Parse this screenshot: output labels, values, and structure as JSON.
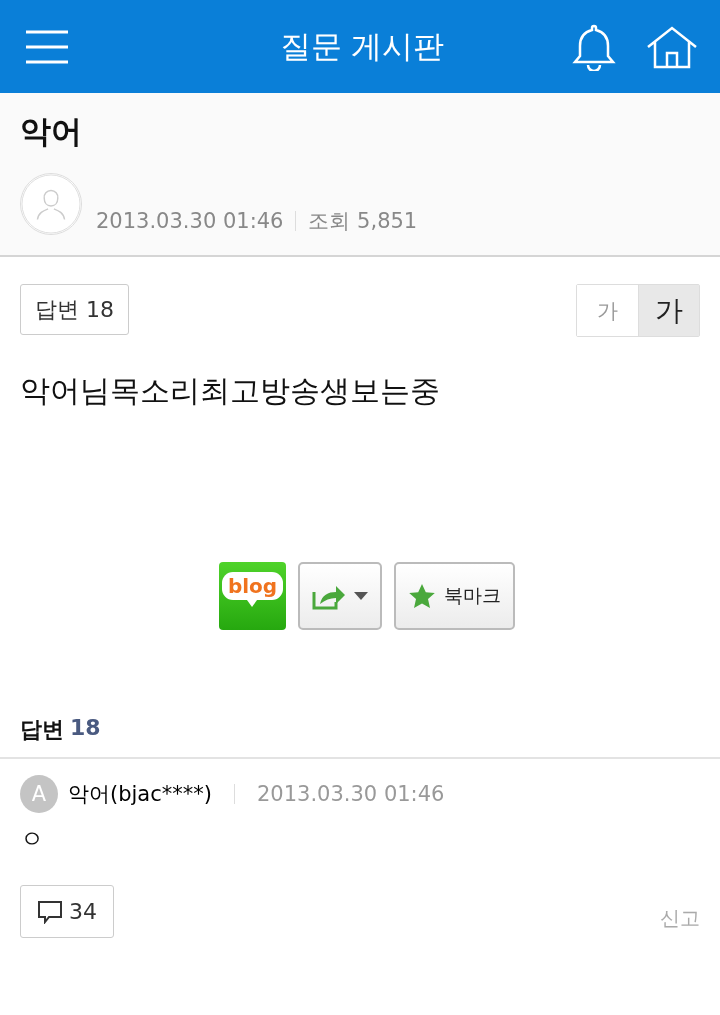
{
  "header": {
    "title": "질문 게시판"
  },
  "question": {
    "title": "악어",
    "date": "2013.03.30 01:46",
    "views_label": "조회",
    "views": "5,851"
  },
  "answer_count_badge": {
    "label": "답변",
    "count": "18"
  },
  "font_size_toggle": [
    {
      "label": "가",
      "kind": "small",
      "selected": false
    },
    {
      "label": "가",
      "kind": "large",
      "selected": true
    }
  ],
  "body": "악어님목소리최고방송생보는중",
  "share": {
    "blog_logo": "blog",
    "bookmark": "북마크"
  },
  "answers_header": {
    "label": "답변",
    "count": "18"
  },
  "answers": [
    {
      "avatar_letter": "A",
      "author": "악어(bjac****)",
      "date": "2013.03.30 01:46",
      "text": "ㅇ",
      "comments": "34",
      "report": "신고"
    }
  ]
}
